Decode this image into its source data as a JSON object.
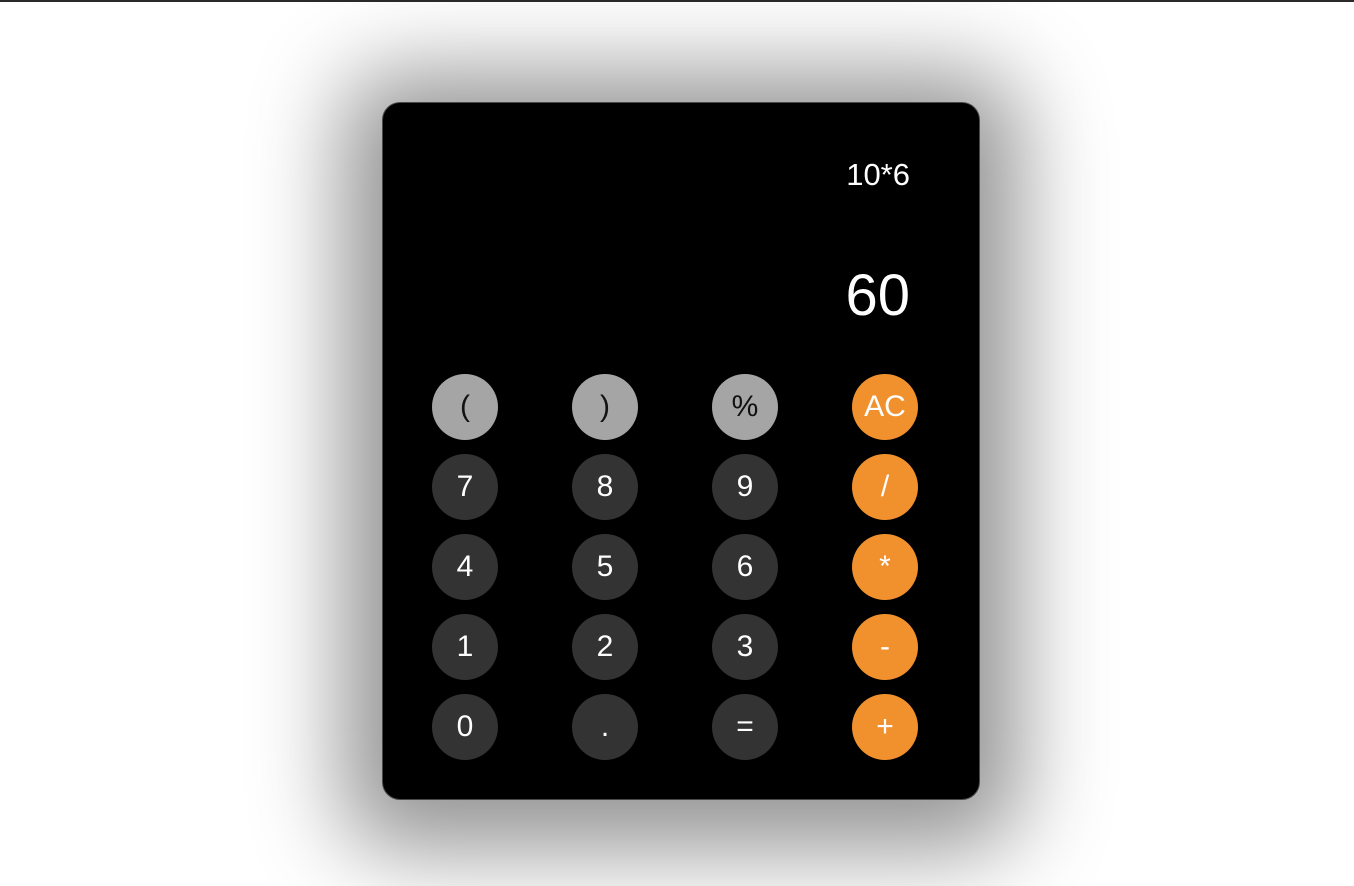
{
  "display": {
    "expression": "10*6",
    "result": "60"
  },
  "keys": [
    {
      "id": "open-paren",
      "label": "(",
      "kind": "fn"
    },
    {
      "id": "close-paren",
      "label": ")",
      "kind": "fn"
    },
    {
      "id": "percent",
      "label": "%",
      "kind": "fn"
    },
    {
      "id": "all-clear",
      "label": "AC",
      "kind": "op"
    },
    {
      "id": "7",
      "label": "7",
      "kind": "num"
    },
    {
      "id": "8",
      "label": "8",
      "kind": "num"
    },
    {
      "id": "9",
      "label": "9",
      "kind": "num"
    },
    {
      "id": "divide",
      "label": "/",
      "kind": "op"
    },
    {
      "id": "4",
      "label": "4",
      "kind": "num"
    },
    {
      "id": "5",
      "label": "5",
      "kind": "num"
    },
    {
      "id": "6",
      "label": "6",
      "kind": "num"
    },
    {
      "id": "multiply",
      "label": "*",
      "kind": "op"
    },
    {
      "id": "1",
      "label": "1",
      "kind": "num"
    },
    {
      "id": "2",
      "label": "2",
      "kind": "num"
    },
    {
      "id": "3",
      "label": "3",
      "kind": "num"
    },
    {
      "id": "subtract",
      "label": "-",
      "kind": "op"
    },
    {
      "id": "0",
      "label": "0",
      "kind": "num"
    },
    {
      "id": "decimal",
      "label": ".",
      "kind": "num"
    },
    {
      "id": "equals",
      "label": "=",
      "kind": "num"
    },
    {
      "id": "add",
      "label": "+",
      "kind": "op"
    }
  ],
  "colors": {
    "body": "#000000",
    "function_key": "#a5a5a5",
    "number_key": "#333333",
    "operator_key": "#f1912e",
    "text": "#ffffff"
  }
}
